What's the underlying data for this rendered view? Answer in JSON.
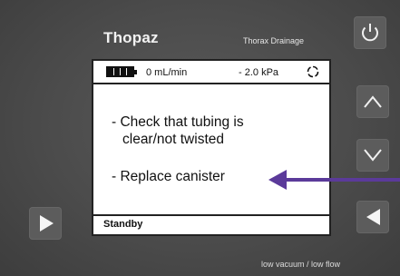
{
  "header": {
    "brand": "Thopaz",
    "subtitle": "Thorax Drainage"
  },
  "status_bar": {
    "battery_icon": "battery-full-icon",
    "flow": "0 mL/min",
    "pressure": "- 2.0 kPa",
    "activity_icon": "spinner-icon"
  },
  "message": {
    "line1": "- Check that tubing is",
    "line2": "clear/not twisted",
    "line3": "- Replace canister"
  },
  "footer": {
    "mode": "Standby"
  },
  "alarm_text": "low vacuum / low flow",
  "buttons": {
    "power": "power-icon",
    "up": "chevron-up-icon",
    "down": "chevron-down-icon",
    "left_play": "play-right-icon",
    "right_back": "play-left-icon"
  },
  "colors": {
    "annotation_arrow": "#5b3a9a",
    "device": "#4b4b4b",
    "screen": "#ffffff"
  }
}
